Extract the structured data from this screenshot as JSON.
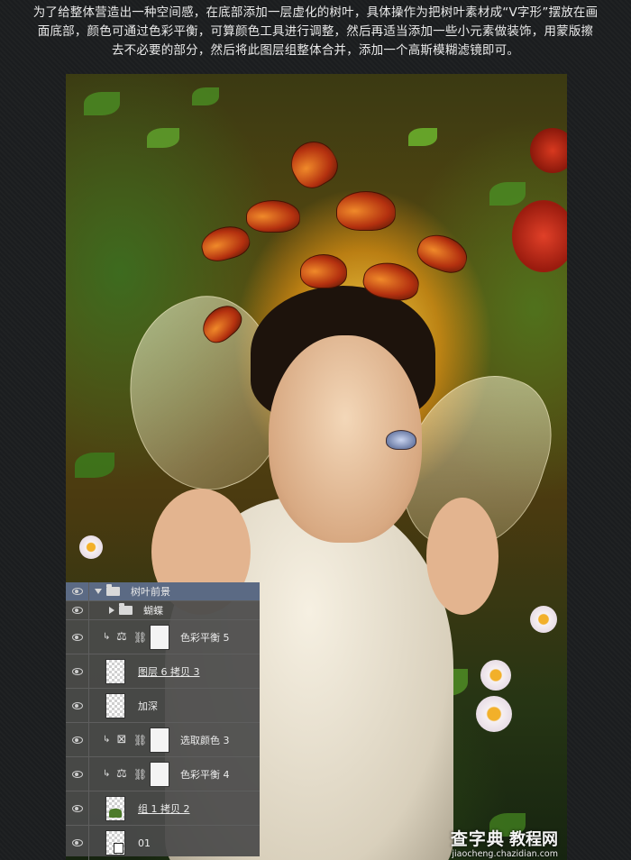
{
  "caption": {
    "line1": "为了给整体营造出一种空间感，在底部添加一层虚化的树叶，具体操作为把树叶素材成“V字形”摆放在画",
    "line2": "面底部，颜色可通过色彩平衡，可算颜色工具进行调整，然后再适当添加一些小元素做装饰，用蒙版擦",
    "line3": "去不必要的部分，然后将此图层组整体合并，添加一个高斯模糊滤镜即可。"
  },
  "layers_panel": {
    "layers": [
      {
        "name": "树叶前景",
        "type": "group",
        "expanded": true
      },
      {
        "name": "蝴蝶",
        "type": "group",
        "expanded": false
      },
      {
        "name": "色彩平衡 5",
        "type": "adjustment",
        "icon": "balance-scale-icon"
      },
      {
        "name": "图层 6 拷贝 3",
        "type": "pixel"
      },
      {
        "name": "加深",
        "type": "pixel"
      },
      {
        "name": "选取颜色 3",
        "type": "adjustment",
        "icon": "selective-color-icon"
      },
      {
        "name": "色彩平衡 4",
        "type": "adjustment",
        "icon": "balance-scale-icon"
      },
      {
        "name": "组 1 拷贝 2",
        "type": "pixel"
      },
      {
        "name": "01",
        "type": "smart-object"
      }
    ]
  },
  "watermark": {
    "main": "查字典",
    "sub": "教程网",
    "url": "jiaocheng.chazidian.com"
  },
  "colors": {
    "background": "#1c1e20",
    "panel": "#4a4a4a",
    "selected_row": "#5b6a84"
  }
}
